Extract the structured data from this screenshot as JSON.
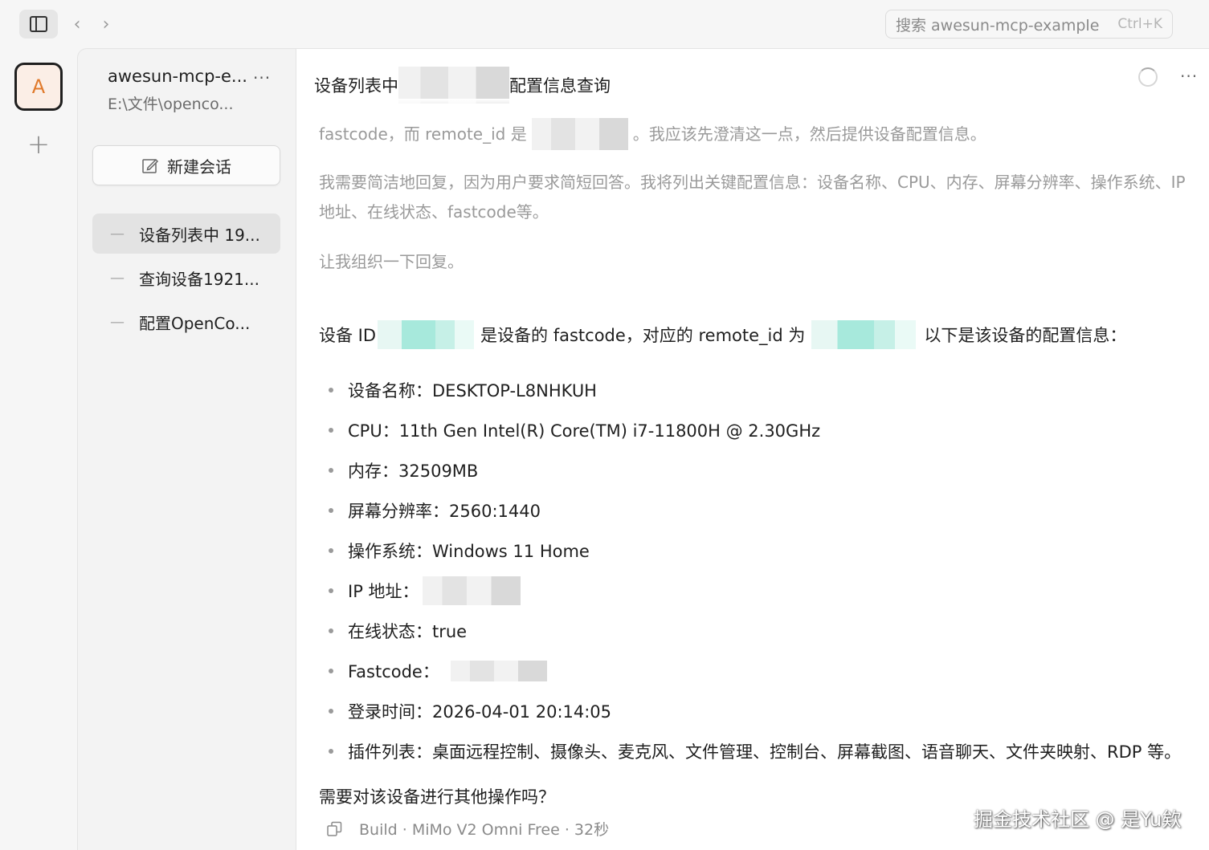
{
  "topbar": {
    "search_placeholder": "搜索 awesun-mcp-example",
    "search_shortcut": "Ctrl+K"
  },
  "rail": {
    "avatar_letter": "A"
  },
  "sidebar": {
    "project_name": "awesun-mcp-e...",
    "project_path": "E:\\文件\\openco...",
    "new_session_label": "新建会话",
    "sessions": [
      {
        "label": "设备列表中 19...",
        "active": true
      },
      {
        "label": "查询设备1921...",
        "active": false
      },
      {
        "label": "配置OpenCo...",
        "active": false
      }
    ]
  },
  "main": {
    "title_prefix": "设备列表中",
    "title_suffix": "配置信息查询",
    "thinking": {
      "line1_a": "fastcode，而 remote_id 是",
      "line1_b": "。我应该先澄清这一点，然后提供设备配置信息。",
      "para2": "我需要简洁地回复，因为用户要求简短回答。我将列出关键配置信息：设备名称、CPU、内存、屏幕分辨率、操作系统、IP地址、在线状态、fastcode等。",
      "para3": "让我组织一下回复。"
    },
    "answer": {
      "intro_a": "设备 ID",
      "intro_b": "是设备的 fastcode，对应的 remote_id 为",
      "intro_c": "以下是该设备的配置信息：",
      "items": [
        "设备名称：DESKTOP-L8NHKUH",
        "CPU：11th Gen Intel(R) Core(TM) i7-11800H @ 2.30GHz",
        "内存：32509MB",
        "屏幕分辨率：2560:1440",
        "操作系统：Windows 11 Home",
        "IP 地址：",
        "在线状态：true",
        "Fastcode：",
        "登录时间：2026-04-01 20:14:05",
        "插件列表：桌面远程控制、摄像头、麦克风、文件管理、控制台、屏幕截图、语音聊天、文件夹映射、RDP 等。"
      ],
      "closing": "需要对该设备进行其他操作吗？"
    },
    "meta": "Build · MiMo V2 Omni Free · 32秒"
  },
  "watermark": "掘金技术社区 @ 是Yu欸",
  "colors": {
    "accent_orange": "#e07a2c",
    "active_session_bg": "#e3e3e3",
    "redaction_teal": "#a7e9dc"
  }
}
